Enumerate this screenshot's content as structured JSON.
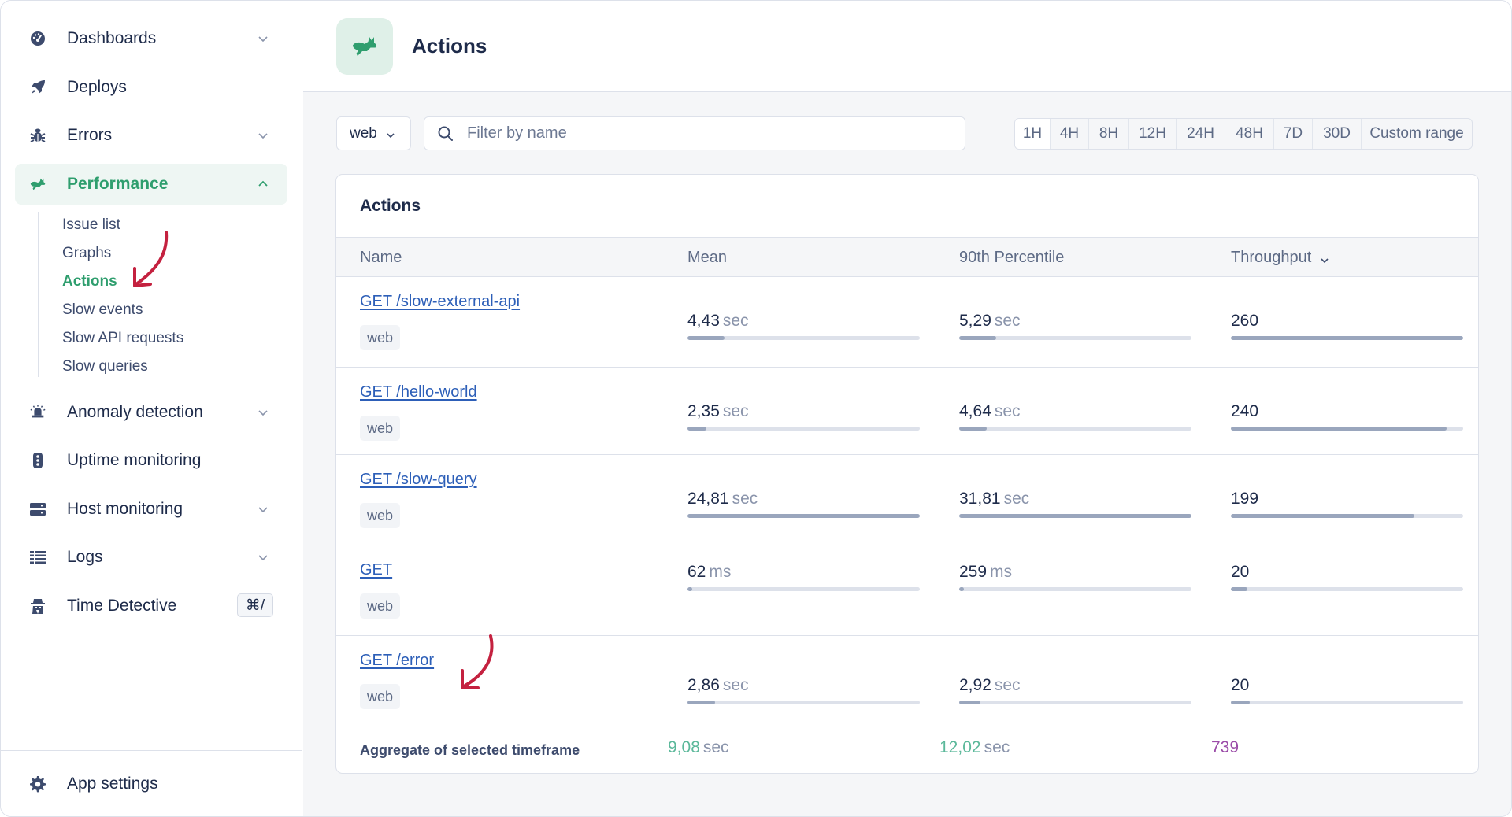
{
  "sidebar": {
    "items": [
      {
        "label": "Dashboards",
        "icon": "dashboard-gauge-icon",
        "expandable": true
      },
      {
        "label": "Deploys",
        "icon": "rocket-icon",
        "expandable": false
      },
      {
        "label": "Errors",
        "icon": "bug-icon",
        "expandable": true
      },
      {
        "label": "Performance",
        "icon": "rabbit-icon",
        "expandable": true,
        "active": true
      },
      {
        "label": "Anomaly detection",
        "icon": "siren-icon",
        "expandable": true
      },
      {
        "label": "Uptime monitoring",
        "icon": "traffic-light-icon",
        "expandable": false
      },
      {
        "label": "Host monitoring",
        "icon": "server-icon",
        "expandable": true
      },
      {
        "label": "Logs",
        "icon": "list-icon",
        "expandable": true
      },
      {
        "label": "Time Detective",
        "icon": "detective-icon",
        "shortcut": "⌘/"
      }
    ],
    "performance_subitems": [
      {
        "label": "Issue list"
      },
      {
        "label": "Graphs"
      },
      {
        "label": "Actions",
        "active": true
      },
      {
        "label": "Slow events"
      },
      {
        "label": "Slow API requests"
      },
      {
        "label": "Slow queries"
      }
    ],
    "footer": {
      "label": "App settings",
      "icon": "gear-icon"
    }
  },
  "header": {
    "title": "Actions",
    "icon": "rabbit-icon"
  },
  "filters": {
    "namespace": "web",
    "search_placeholder": "Filter by name",
    "search_value": "",
    "time_ranges": [
      "1H",
      "4H",
      "8H",
      "12H",
      "24H",
      "48H",
      "7D",
      "30D",
      "Custom range"
    ],
    "selected_range": "1H"
  },
  "table": {
    "title": "Actions",
    "columns": {
      "name": "Name",
      "mean": "Mean",
      "p90": "90th Percentile",
      "throughput": "Throughput"
    },
    "sort_column": "throughput",
    "rows": [
      {
        "name": "GET /slow-external-api",
        "tag": "web",
        "mean": {
          "value": "4,43",
          "unit": "sec",
          "fill": 0.16
        },
        "p90": {
          "value": "5,29",
          "unit": "sec",
          "fill": 0.16
        },
        "throughput": {
          "value": "260",
          "fill": 1.0
        }
      },
      {
        "name": "GET /hello-world",
        "tag": "web",
        "mean": {
          "value": "2,35",
          "unit": "sec",
          "fill": 0.08
        },
        "p90": {
          "value": "4,64",
          "unit": "sec",
          "fill": 0.12
        },
        "throughput": {
          "value": "240",
          "fill": 0.93
        }
      },
      {
        "name": "GET /slow-query",
        "tag": "web",
        "mean": {
          "value": "24,81",
          "unit": "sec",
          "fill": 1.0
        },
        "p90": {
          "value": "31,81",
          "unit": "sec",
          "fill": 1.0
        },
        "throughput": {
          "value": "199",
          "fill": 0.79
        }
      },
      {
        "name": "GET",
        "tag": "web",
        "mean": {
          "value": "62",
          "unit": "ms",
          "fill": 0.02
        },
        "p90": {
          "value": "259",
          "unit": "ms",
          "fill": 0.02
        },
        "throughput": {
          "value": "20",
          "fill": 0.07
        }
      },
      {
        "name": "GET /error",
        "tag": "web",
        "mean": {
          "value": "2,86",
          "unit": "sec",
          "fill": 0.12
        },
        "p90": {
          "value": "2,92",
          "unit": "sec",
          "fill": 0.09
        },
        "throughput": {
          "value": "20",
          "fill": 0.08
        }
      }
    ],
    "aggregate": {
      "label": "Aggregate of selected timeframe",
      "mean": {
        "value": "9,08",
        "unit": "sec"
      },
      "p90": {
        "value": "12,02",
        "unit": "sec"
      },
      "throughput": {
        "value": "739"
      }
    }
  },
  "colors": {
    "accent_green": "#2f9e6e",
    "aggregate_green": "#5bb89a",
    "aggregate_purple": "#9b4ca8",
    "link_blue": "#2d5fb8",
    "annotation_red": "#c4213f"
  }
}
